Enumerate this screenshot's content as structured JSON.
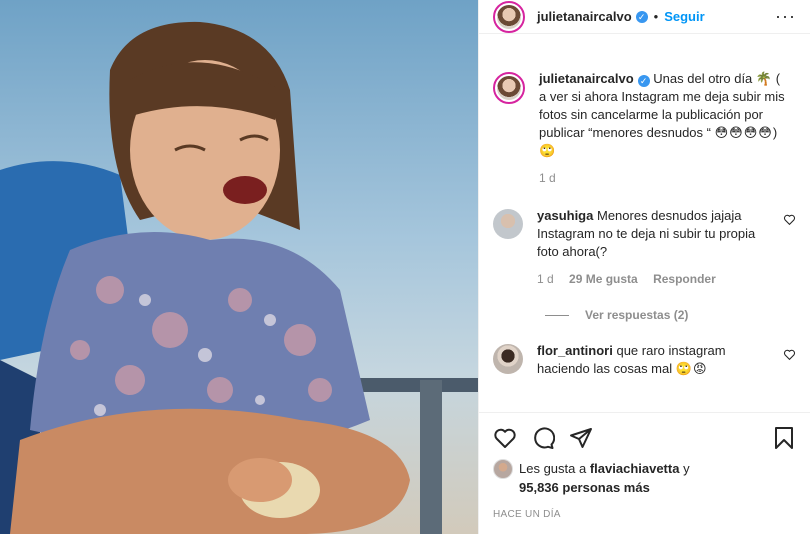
{
  "post": {
    "username": "julietanaircalvo",
    "dot": "•",
    "follow_label": "Seguir",
    "more_label": "···"
  },
  "caption": {
    "username": "julietanaircalvo",
    "text_1": "Unas del otro día",
    "emoji_palm": "🌴",
    "text_2": "( a ver si ahora Instagram me deja subir mis fotos sin cancelarme la publicación por publicar “menores desnudos “",
    "emojis_1": "😳😳😳😳",
    "text_3": ")",
    "emojis_2": "🙄",
    "time": "1 d"
  },
  "comments": [
    {
      "username": "yasuhiga",
      "text": "Menores desnudos jajaja Instagram no te deja ni subir tu propia foto ahora(?",
      "time": "1 d",
      "likes": "29 Me gusta",
      "reply_label": "Responder",
      "view_replies": "Ver respuestas (2)"
    },
    {
      "username": "flor_antinori",
      "text": "que raro instagram haciendo las cosas mal",
      "emojis": "🙄😡"
    }
  ],
  "likes": {
    "prefix": "Les gusta a",
    "user": "flaviachiavetta",
    "conj": "y",
    "count": "95,836 personas más"
  },
  "timestamp": "HACE UN DÍA",
  "icons": [
    "heart-icon",
    "comment-icon",
    "share-icon",
    "bookmark-icon",
    "verified-icon",
    "more-icon"
  ],
  "colors": {
    "link": "#0095f6",
    "muted": "#8e8e8e",
    "verified": "#3897f0"
  }
}
